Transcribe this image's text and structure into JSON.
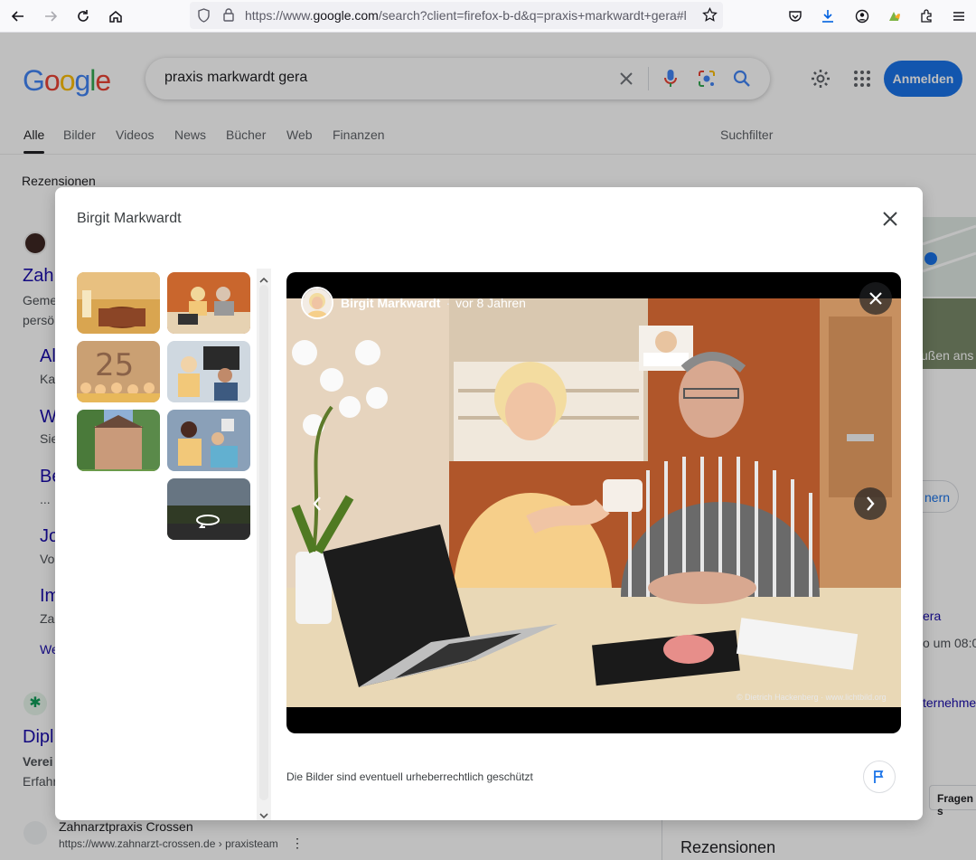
{
  "browser": {
    "url_prefix": "https://www.",
    "url_domain": "google.com",
    "url_rest": "/search?client=firefox-b-d&q=praxis+markwardt+gera#l"
  },
  "google": {
    "logo": "Google",
    "query": "praxis markwardt gera",
    "signin": "Anmelden",
    "tabs": [
      "Alle",
      "Bilder",
      "Videos",
      "News",
      "Bücher",
      "Web",
      "Finanzen"
    ],
    "search_filter": "Suchfilter",
    "reviews_tab": "Rezensionen"
  },
  "background": {
    "result_title_1": "Zah",
    "snippet_1a": "Geme",
    "snippet_1b": "persö",
    "link_a": "Al",
    "link_a_sub": "Ka",
    "link_w": "W",
    "link_w_sub": "Sie",
    "link_be": "Be",
    "link_be_sub": "...",
    "link_jo": "Jo",
    "link_jo_sub": "Vo",
    "link_im": "Im",
    "link_im_sub": "Za",
    "link_we": "We",
    "result_title_2": "Dipl",
    "snippet_2a": "Verei",
    "snippet_2b": "Erfahr",
    "result_3_title": "Zahnarztpraxis Crossen",
    "result_3_url": "https://www.zahnarzt-crossen.de › praxisteam",
    "right_outside": "ußen ans",
    "right_nern": "nern",
    "right_gera": "era",
    "right_hours": "o um 08:0",
    "right_company": "ternehme",
    "right_ask": "Fragen s",
    "right_reviews": "Rezensionen"
  },
  "modal": {
    "title": "Birgit Markwardt",
    "viewer": {
      "author": "Birgit Markwardt",
      "separator": "·",
      "time": "vor 8 Jahren",
      "credit": "© Dietrich Hackenberg · www.lichtbild.org"
    },
    "copyright_notice": "Die Bilder sind eventuell urheberrechtlich geschützt"
  },
  "colors": {
    "accent": "#1a73e8",
    "link": "#1a0dab"
  }
}
